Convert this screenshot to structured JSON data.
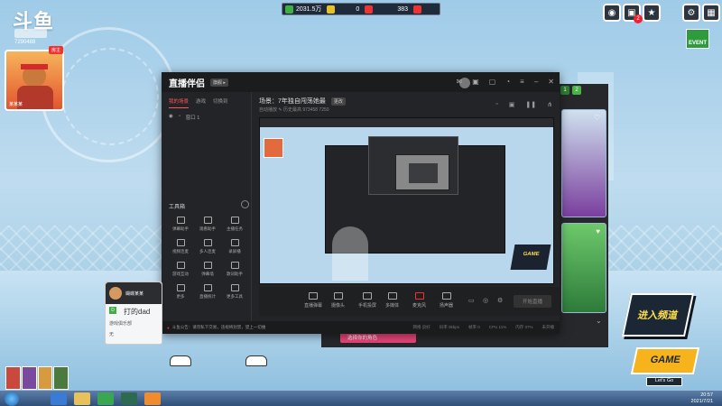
{
  "brand": {
    "logo": "斗鱼",
    "room_id": "7290488"
  },
  "top_stats": {
    "value1": "2031.5万",
    "value2": "0",
    "value3": "383"
  },
  "top_right": {
    "event_label": "EVENT",
    "badge_count": "2"
  },
  "avatar": {
    "name": "某某某",
    "tag": "房主"
  },
  "app": {
    "logo": "直播伴侣",
    "version_badge": "旗舰 ▸",
    "left_tabs": [
      "我的场景",
      "游戏",
      "切换到"
    ],
    "scene_label": "窗口 1",
    "tools_title": "工具箱",
    "tools": [
      "弹幕助手",
      "观看助手",
      "主播任务",
      "视频连麦",
      "多人连麦",
      "录屏播",
      "游戏互动",
      "弹幕墙",
      "歌词助手",
      "更多",
      "直播统计",
      "更多工具"
    ],
    "preview_title": "场景：7年独自闯荡她最",
    "preview_title_tag": "更改",
    "preview_sub": "自动播放 ✎   历史最高 973458   7250",
    "bottom_tools": [
      "直播弹幕",
      "摄像头",
      "手机投屏",
      "多媒体",
      "麦克风",
      "扬声器"
    ],
    "start_button": "开始直播",
    "status_text": "斗鱼公告：请勿私下交易，违规将封禁，望上一切维",
    "status_right": [
      "网络 良好",
      "码率 0kbps",
      "帧率 0",
      "CPU 11%",
      "内存 37%",
      "未开播"
    ]
  },
  "right_panel": {
    "chips": [
      "1",
      "2"
    ],
    "button": "选择你的角色"
  },
  "chat": {
    "name": "蝴蝶某某",
    "title": "打的dad",
    "line1": "游戏俱乐部",
    "line2": "无"
  },
  "promo": {
    "enter": "进入频道",
    "game": "GAME",
    "lets": "Let's Go"
  },
  "clock": {
    "time": "20:57",
    "date": "2021/7/21"
  }
}
